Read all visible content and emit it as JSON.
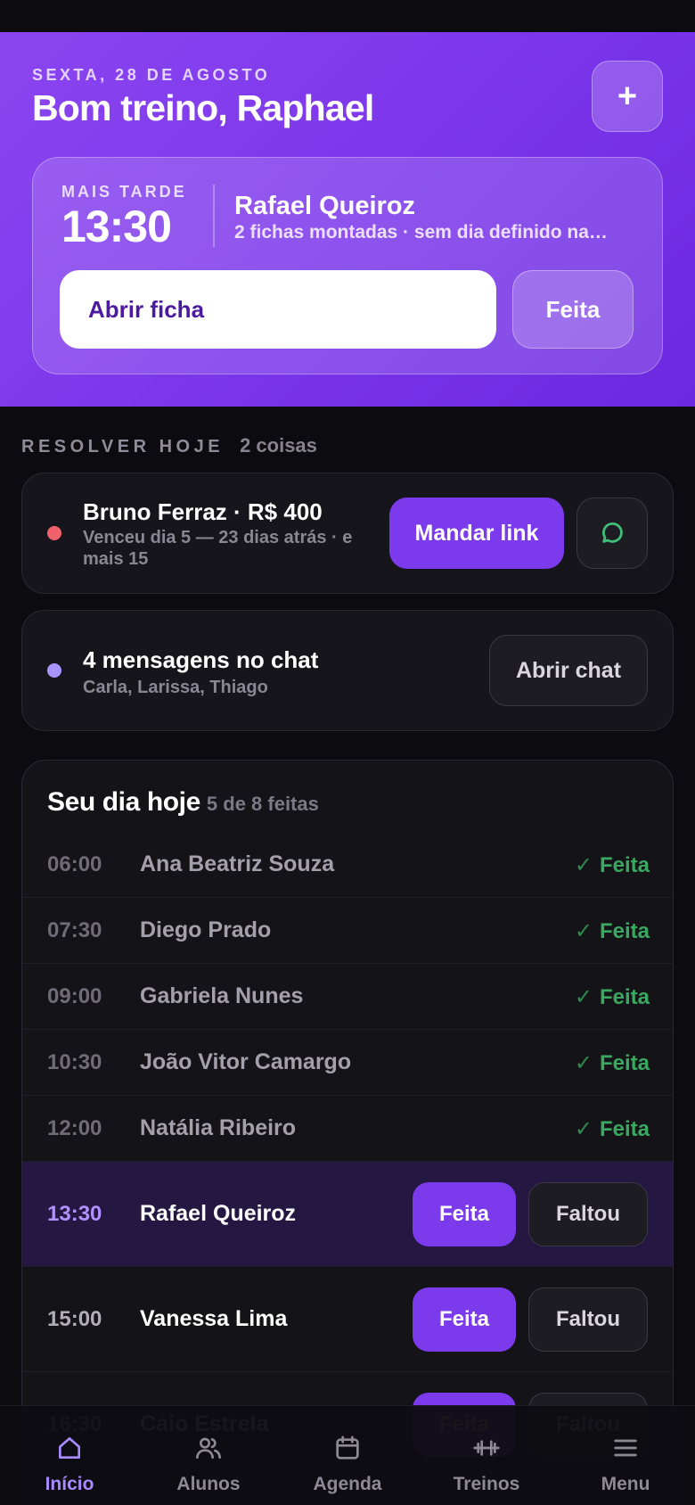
{
  "hero": {
    "date": "SEXTA, 28 DE AGOSTO",
    "greeting": "Bom treino, Raphael",
    "add_label": "+",
    "next": {
      "label": "MAIS TARDE",
      "time": "13:30",
      "name": "Rafael Queiroz",
      "subtitle": "2 fichas montadas · sem dia definido na…",
      "open_label": "Abrir ficha",
      "done_label": "Feita"
    }
  },
  "resolve": {
    "title": "RESOLVER HOJE",
    "count": "2 coisas",
    "items": [
      {
        "title": "Bruno Ferraz · R$ 400",
        "subtitle": "Venceu dia 5 — 23 dias atrás · e mais 15",
        "action": "Mandar link",
        "dot_color": "#f0626b",
        "icon": "chat-bubble-icon"
      },
      {
        "title": "4 mensagens no chat",
        "subtitle": "Carla, Larissa, Thiago",
        "action": "Abrir chat",
        "dot_color": "#a894ff"
      }
    ]
  },
  "day": {
    "title": "Seu dia hoje",
    "count": "5 de 8 feitas",
    "done_label": "Feita",
    "missed_label": "Faltou",
    "check": "✓",
    "rows": [
      {
        "time": "06:00",
        "name": "Ana Beatriz Souza",
        "status": "done"
      },
      {
        "time": "07:30",
        "name": "Diego Prado",
        "status": "done"
      },
      {
        "time": "09:00",
        "name": "Gabriela Nunes",
        "status": "done"
      },
      {
        "time": "10:30",
        "name": "João Vitor Camargo",
        "status": "done"
      },
      {
        "time": "12:00",
        "name": "Natália Ribeiro",
        "status": "done"
      },
      {
        "time": "13:30",
        "name": "Rafael Queiroz",
        "status": "current"
      },
      {
        "time": "15:00",
        "name": "Vanessa Lima",
        "status": "pending"
      },
      {
        "time": "16:30",
        "name": "Caio Estrela",
        "status": "pending"
      }
    ]
  },
  "tabs": [
    {
      "label": "Início",
      "icon": "home-icon",
      "active": true
    },
    {
      "label": "Alunos",
      "icon": "users-icon",
      "active": false
    },
    {
      "label": "Agenda",
      "icon": "calendar-icon",
      "active": false
    },
    {
      "label": "Treinos",
      "icon": "dumbbell-icon",
      "active": false
    },
    {
      "label": "Menu",
      "icon": "menu-icon",
      "active": false
    }
  ],
  "colors": {
    "accent": "#7c3aed",
    "done": "#3aa860",
    "active_tab": "#a98bff"
  }
}
